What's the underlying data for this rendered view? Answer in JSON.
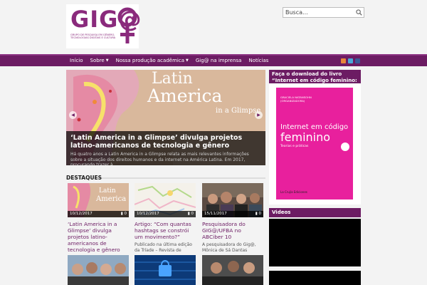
{
  "header": {
    "logo_text": "GIG@",
    "logo_tagline": "GRUPO DE PESQUISA EM GÊNERO, TECNOLOGIAS DIGITAIS E CULTURA",
    "search_placeholder": "Busca..."
  },
  "nav": {
    "items": [
      {
        "label": "Início",
        "dropdown": false
      },
      {
        "label": "Sobre",
        "dropdown": true
      },
      {
        "label": "Nossa produção acadêmica",
        "dropdown": true
      },
      {
        "label": "Gig@ na imprensa",
        "dropdown": false
      },
      {
        "label": "Notícias",
        "dropdown": false
      }
    ],
    "social_icons": [
      "rss-icon",
      "twitter-icon",
      "facebook-icon"
    ],
    "colors": {
      "bar": "#6c1c63",
      "rss": "#e8863a",
      "twitter": "#49a9d9",
      "facebook": "#3b5998"
    }
  },
  "slider": {
    "image_title_1": "Latin",
    "image_title_2": "America",
    "image_title_3": "in a Glimpse",
    "title": "‘Latin America in a Glimpse’ divulga projetos latino-americanos de tecnologia e gênero",
    "excerpt": "Há quatro anos a Latin America in a Glimpse relata as mais relevantes informações sobre a situação dos direitos humanos e da internet na América Latina. Em 2017, procurando trazer à"
  },
  "destaques": {
    "heading": "DESTAQUES",
    "cards": [
      {
        "date": "10/12/2017",
        "comments": "0",
        "title": "‘Latin America in a Glimpse’ divulga projetos latino-americanos de tecnologia e gênero",
        "excerpt": "",
        "thumb_text_1": "Latin",
        "thumb_text_2": "America"
      },
      {
        "date": "10/12/2017",
        "comments": "0",
        "title": "Artigo: “Com quantas hashtags se constrói um movimento?”",
        "excerpt": "Publicado na última edição da Tríade – Revista de"
      },
      {
        "date": "15/11/2017",
        "comments": "0",
        "title": "Pesquisadora do GIG@/UFBA no ABCiber 10",
        "excerpt": "A pesquisadora do Gig@, Mônica de Sá Dantas"
      }
    ]
  },
  "sidebar": {
    "book_heading": "Faça o download do livro “Internet em código feminino: teorias e práticas”",
    "book": {
      "author_1": "GRACIELA NATANSOHN",
      "author_2": "(ORGANIZADORA)",
      "title_1": "Internet em código",
      "title_2": "feminino",
      "subtitle": "Teorias e práticas",
      "publisher": "La Crujía Ediciones"
    },
    "videos_heading": "Videos"
  }
}
